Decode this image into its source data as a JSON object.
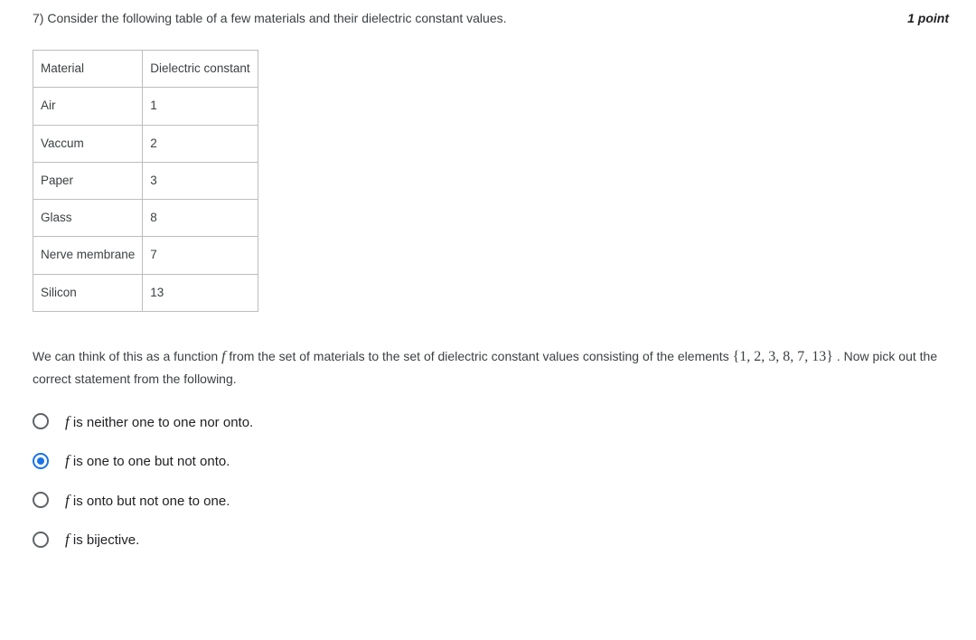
{
  "question": {
    "number": "7)",
    "prompt": "Consider the following table of a few materials and their dielectric constant values.",
    "points": "1 point"
  },
  "table": {
    "headers": [
      "Material",
      "Dielectric constant"
    ],
    "rows": [
      {
        "material": "Air",
        "value": "1"
      },
      {
        "material": "Vaccum",
        "value": "2"
      },
      {
        "material": "Paper",
        "value": "3"
      },
      {
        "material": "Glass",
        "value": "8"
      },
      {
        "material": "Nerve membrane",
        "value": "7"
      },
      {
        "material": "Silicon",
        "value": "13"
      }
    ]
  },
  "explanation": {
    "pre": "We can think of this as a function ",
    "fvar": "f",
    "mid": " from the set of materials to the set of dielectric constant values consisting of the elements ",
    "set": "{1, 2, 3, 8, 7, 13}",
    "post": " . Now pick out the correct statement from the following."
  },
  "options": [
    {
      "f": "f",
      "text": " is neither one to one nor onto.",
      "selected": false
    },
    {
      "f": "f",
      "text": " is one to one but not onto.",
      "selected": true
    },
    {
      "f": "f",
      "text": " is onto but not one to one.",
      "selected": false
    },
    {
      "f": "f",
      "text": " is bijective.",
      "selected": false
    }
  ]
}
